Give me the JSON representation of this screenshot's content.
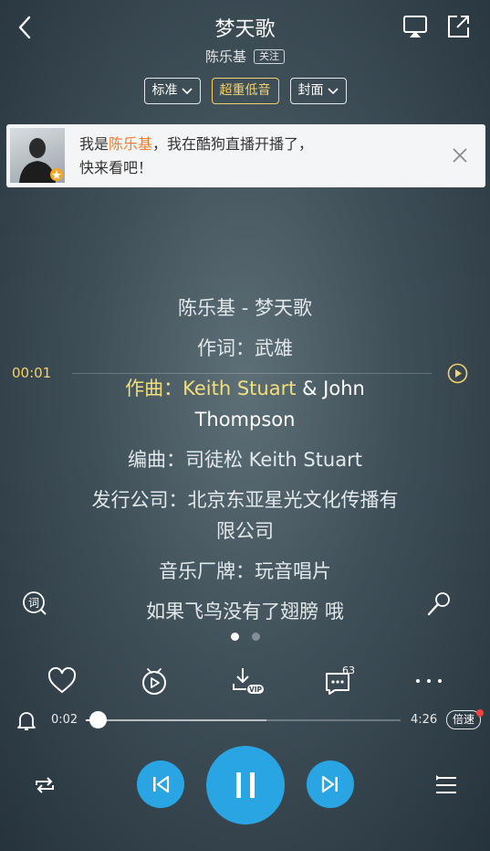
{
  "header": {
    "title": "梦天歌",
    "artist": "陈乐基",
    "follow_label": "关注"
  },
  "options": [
    {
      "label": "标准",
      "dropdown": true
    },
    {
      "label": "超重低音",
      "dropdown": false,
      "active": true
    },
    {
      "label": "封面",
      "dropdown": true
    }
  ],
  "notice": {
    "prefix": "我是",
    "name": "陈乐基",
    "rest": "，我在酷狗直播开播了，",
    "line2": "快来看吧！"
  },
  "lyrics": {
    "line1": "陈乐基 - 梦天歌",
    "line2": "作词：武雄",
    "line3_prefix": "作曲：",
    "line3_a": "Keith Stuart",
    "line3_b": " & John Thompson",
    "line4": "编曲：司徒松 Keith Stuart",
    "line5": "发行公司：北京东亚星光文化传播有限公司",
    "line6": "音乐厂牌：玩音唱片",
    "line7": "如果飞鸟没有了翅膀 哦",
    "time_mark": "00:01"
  },
  "comment_count": "63",
  "progress": {
    "current": "0:02",
    "total": "4:26",
    "fraction": 0.008,
    "speed_label": "倍速"
  },
  "colors": {
    "accent": "#2aa5e3",
    "lyric_highlight": "#f3df7a",
    "notice_name": "#f07c2d"
  }
}
